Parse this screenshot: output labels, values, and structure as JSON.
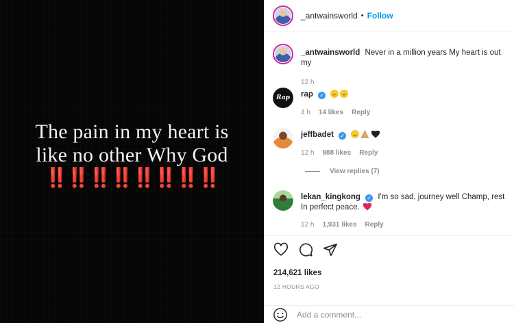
{
  "post": {
    "image_lines": [
      "The pain in my heart is",
      "like no other Why God"
    ],
    "image_bangs": "‼️‼️‼️‼️‼️‼️‼️‼️",
    "author": "_antwainsworld",
    "follow_label": "Follow"
  },
  "caption": {
    "username": "_antwainsworld",
    "text": "Never in a million years My heart is out my",
    "time": "12 h"
  },
  "comments": [
    {
      "username": "rap",
      "verified": true,
      "text": "",
      "time": "4 h",
      "likes": "14 likes",
      "reply_label": "Reply"
    },
    {
      "username": "jeffbadet",
      "verified": true,
      "text": "",
      "time": "12 h",
      "likes": "988 likes",
      "reply_label": "Reply",
      "view_replies": "View replies (7)"
    },
    {
      "username": "lekan_kingkong",
      "verified": true,
      "text": "I'm so sad, journey well Champ, rest In perfect peace.",
      "time": "12 h",
      "likes": "1,931 likes",
      "reply_label": "Reply"
    }
  ],
  "footer": {
    "likes": "214,621 likes",
    "time": "12 HOURS AGO",
    "comment_placeholder": "Add a comment..."
  },
  "icons": {
    "like": "heart-icon",
    "comment": "comment-icon",
    "share": "share-icon",
    "emoji": "emoji-icon",
    "verified": "verified-icon"
  },
  "colors": {
    "accent": "#0095f6",
    "verified": "#3897f0",
    "bangs": "#e01818",
    "heart": "#e0245e"
  }
}
